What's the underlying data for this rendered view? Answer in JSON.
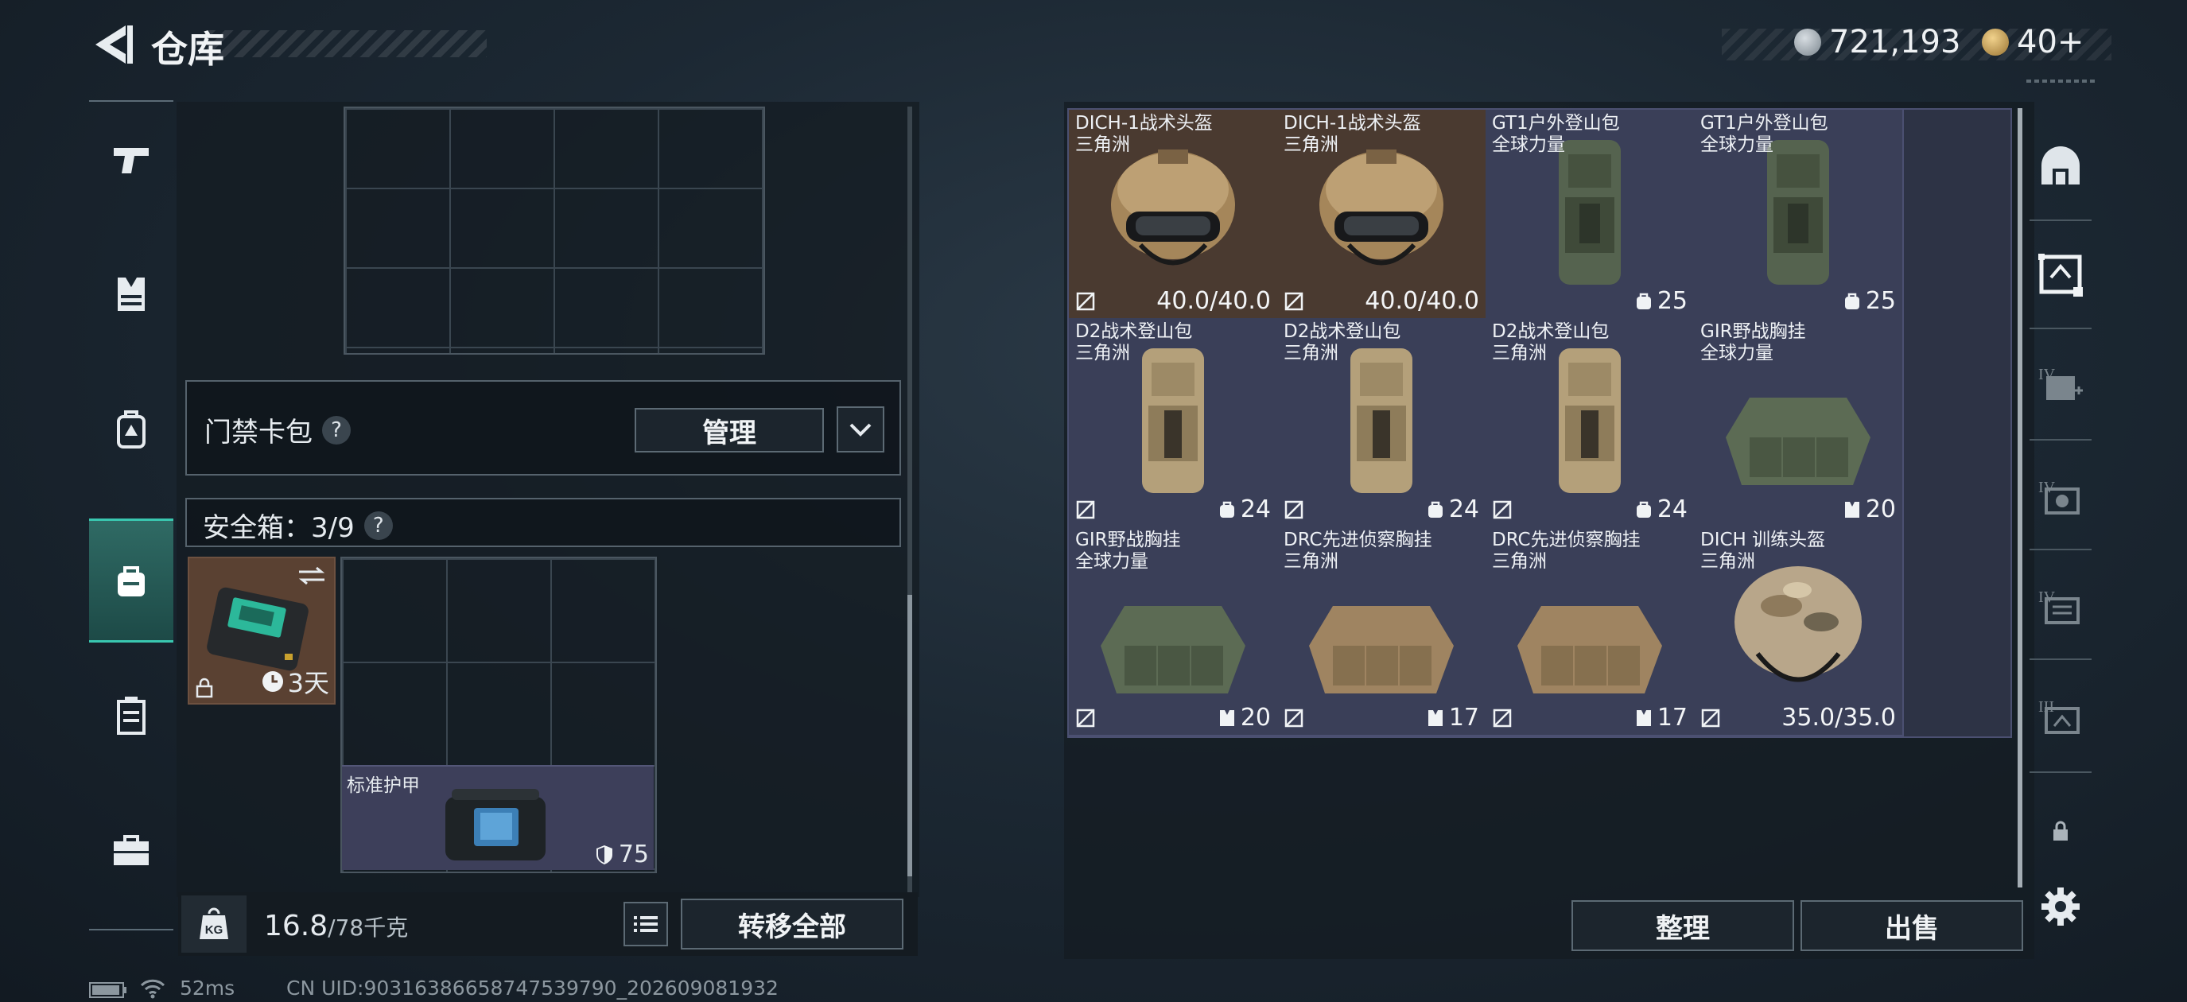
{
  "header": {
    "title": "仓库",
    "currency": [
      {
        "icon": "silver-coin-icon",
        "value": "721,193",
        "color": "#9aa3ab"
      },
      {
        "icon": "gold-triangle-coin-icon",
        "value": "40+",
        "color": "#c9a45a"
      }
    ]
  },
  "left_nav": {
    "items": [
      {
        "icon": "pistol-icon",
        "active": false
      },
      {
        "icon": "chest-rig-icon",
        "active": false
      },
      {
        "icon": "backpack-icon",
        "active": false
      },
      {
        "icon": "secure-case-icon",
        "active": true
      },
      {
        "icon": "medical-kit-icon",
        "active": false
      },
      {
        "icon": "toolbox-icon",
        "active": false
      }
    ]
  },
  "left_panel": {
    "keycard": {
      "label": "门禁卡包",
      "help": "?",
      "manage_label": "管理"
    },
    "safebox": {
      "label": "安全箱：3/9",
      "help": "?"
    },
    "safebox_item": {
      "duration": "3天"
    },
    "armor_item": {
      "name": "标准护甲",
      "value": "75"
    },
    "footer": {
      "weight_current": "16.8",
      "weight_max": "/78千克",
      "transfer_label": "转移全部"
    }
  },
  "stash": {
    "items": [
      {
        "name": "DICH-1战术头盔",
        "sub": "三角洲",
        "value": "40.0/40.0",
        "type": "helmet",
        "bg": "brown",
        "stat_icon": "durability-icon"
      },
      {
        "name": "DICH-1战术头盔",
        "sub": "三角洲",
        "value": "40.0/40.0",
        "type": "helmet",
        "bg": "brown",
        "stat_icon": "durability-icon"
      },
      {
        "name": "GT1户外登山包",
        "sub": "全球力量",
        "value": "25",
        "type": "backpack-green",
        "bg": "purple",
        "stat_icon": "capacity-icon"
      },
      {
        "name": "GT1户外登山包",
        "sub": "全球力量",
        "value": "25",
        "type": "backpack-green",
        "bg": "purple",
        "stat_icon": "capacity-icon"
      },
      {
        "name": "D2战术登山包",
        "sub": "三角洲",
        "value": "24",
        "type": "backpack-tan",
        "bg": "purple",
        "stat_icon": "capacity-icon"
      },
      {
        "name": "D2战术登山包",
        "sub": "三角洲",
        "value": "24",
        "type": "backpack-tan",
        "bg": "purple",
        "stat_icon": "capacity-icon"
      },
      {
        "name": "D2战术登山包",
        "sub": "三角洲",
        "value": "24",
        "type": "backpack-tan",
        "bg": "purple",
        "stat_icon": "capacity-icon"
      },
      {
        "name": "GIR野战胸挂",
        "sub": "全球力量",
        "value": "20",
        "type": "rig-green",
        "bg": "purple",
        "stat_icon": "rig-capacity-icon"
      },
      {
        "name": "GIR野战胸挂",
        "sub": "全球力量",
        "value": "20",
        "type": "rig-green",
        "bg": "purple",
        "stat_icon": "rig-capacity-icon"
      },
      {
        "name": "DRC先进侦察胸挂",
        "sub": "三角洲",
        "value": "17",
        "type": "rig-tan",
        "bg": "purple",
        "stat_icon": "rig-capacity-icon"
      },
      {
        "name": "DRC先进侦察胸挂",
        "sub": "三角洲",
        "value": "17",
        "type": "rig-tan",
        "bg": "purple",
        "stat_icon": "rig-capacity-icon"
      },
      {
        "name": "DICH 训练头盔",
        "sub": "三角洲",
        "value": "35.0/35.0",
        "type": "helmet-camo",
        "bg": "purple",
        "stat_icon": "durability-icon"
      }
    ],
    "sort_label": "整理",
    "sell_label": "出售"
  },
  "right_nav": {
    "items": [
      "safe-house-icon",
      "stash-tab-1-icon",
      "stash-tab-2-icon",
      "stash-tab-3-icon",
      "stash-tab-4-icon",
      "stash-tab-5-icon",
      "lock-icon",
      "settings-icon"
    ]
  },
  "status_bar": {
    "ping": "52ms",
    "uid": "CN UID:9031638665874753979​0_202609081932"
  }
}
